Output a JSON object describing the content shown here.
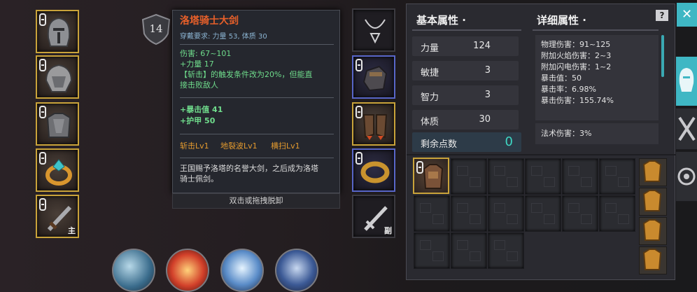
{
  "level_badge": "14",
  "left_slots": [
    {
      "name": "helmet",
      "sub": ""
    },
    {
      "name": "shoulder-armor",
      "sub": ""
    },
    {
      "name": "chest-armor",
      "sub": ""
    },
    {
      "name": "ring",
      "sub": ""
    },
    {
      "name": "main-weapon",
      "sub": "主"
    }
  ],
  "right_slots": [
    {
      "name": "necklace",
      "sub": ""
    },
    {
      "name": "gloves",
      "sub": ""
    },
    {
      "name": "boots",
      "sub": ""
    },
    {
      "name": "bracelet",
      "sub": ""
    },
    {
      "name": "off-weapon",
      "sub": "副"
    }
  ],
  "tooltip": {
    "title": "洛塔骑士大剑",
    "requirement": "穿戴要求:   力量 53, 体质 30",
    "damage": "伤害:   67~101",
    "strength_bonus": "+力量 17",
    "special_1": "【斩击】的触发条件改为20%，但能直",
    "special_2": "接击败敌人",
    "crit_value": "+暴击值 41",
    "armor": "+护甲 50",
    "skills": [
      "斩击Lv1",
      "地裂波Lv1",
      "横扫Lv1"
    ],
    "lore_1": "王国赐予洛塔的名誉大剑，之后成为洛塔",
    "lore_2": "骑士佩剑。",
    "action_hint": "双击或拖拽脱卸"
  },
  "panel": {
    "basic_title": "基本属性 ·",
    "detail_title": "详细属性 ·",
    "help_icon": "?",
    "stats": [
      {
        "label": "力量",
        "value": "124"
      },
      {
        "label": "敏捷",
        "value": "3"
      },
      {
        "label": "智力",
        "value": "3"
      },
      {
        "label": "体质",
        "value": "30"
      }
    ],
    "remaining_label": "剩余点数",
    "remaining_value": "0",
    "details": [
      "物理伤害：91~125",
      "附加火焰伤害：2~3",
      "附加闪电伤害：1~2",
      "暴击值：50",
      "暴击率：6.98%",
      "暴击伤害：155.74%"
    ],
    "magic_damage": "法术伤害：3%"
  },
  "close_icon": "✕",
  "colors": {
    "gold": "#c9a33a",
    "blue": "#5866c8",
    "title": "#e8602a",
    "green": "#6fdc8c",
    "teal": "#3fb7c4"
  }
}
